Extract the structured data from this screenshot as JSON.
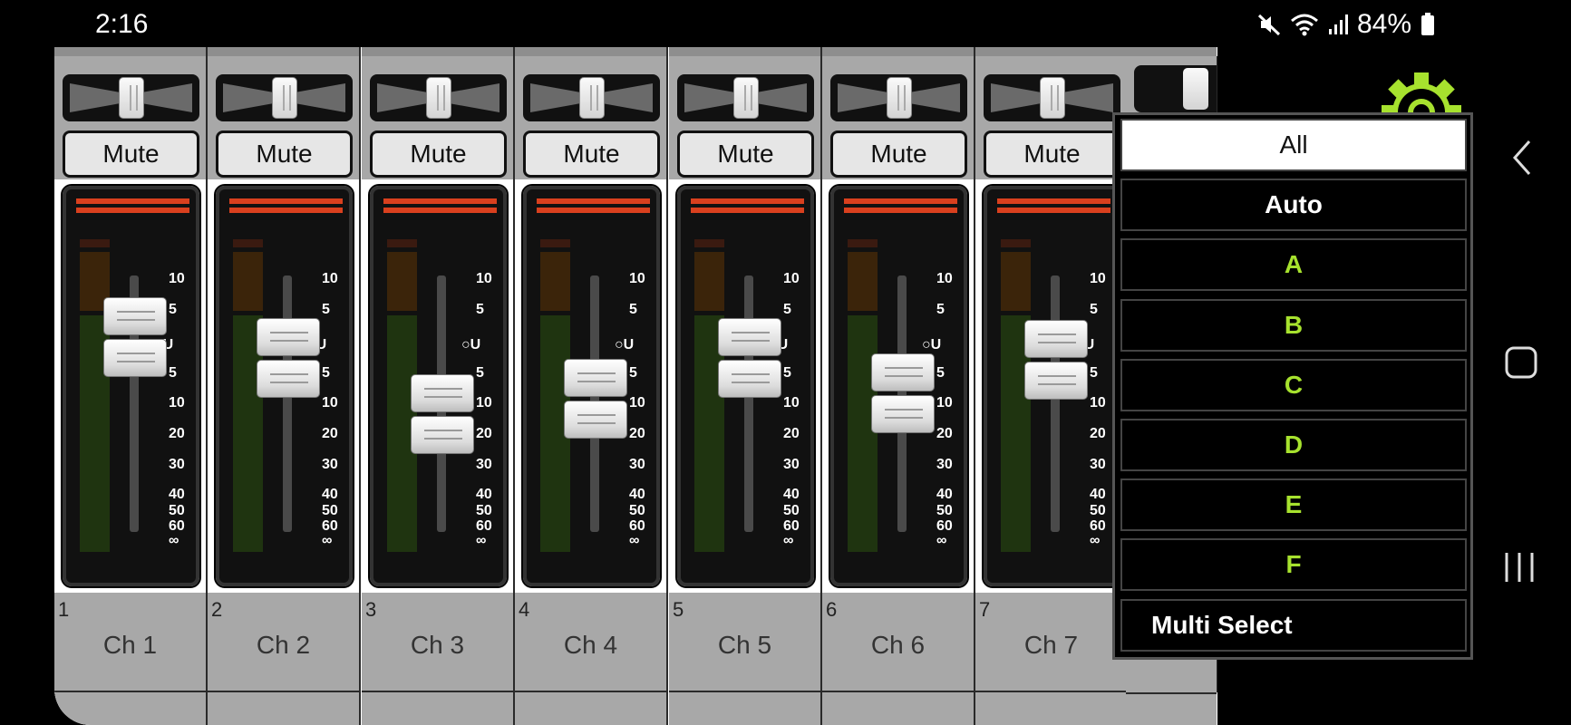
{
  "status_bar": {
    "time": "2:16",
    "battery": "84%",
    "icons": [
      "mute-icon",
      "wifi-icon",
      "signal-icon",
      "battery-icon"
    ]
  },
  "channels": [
    {
      "number": "1",
      "name": "Ch 1",
      "mute_label": "Mute",
      "fader_level": 0.76,
      "pan": 0.5
    },
    {
      "number": "2",
      "name": "Ch 2",
      "mute_label": "Mute",
      "fader_level": 0.68,
      "pan": 0.5
    },
    {
      "number": "3",
      "name": "Ch 3",
      "mute_label": "Mute",
      "fader_level": 0.46,
      "pan": 0.5
    },
    {
      "number": "4",
      "name": "Ch 4",
      "mute_label": "Mute",
      "fader_level": 0.52,
      "pan": 0.5
    },
    {
      "number": "5",
      "name": "Ch 5",
      "mute_label": "Mute",
      "fader_level": 0.68,
      "pan": 0.5
    },
    {
      "number": "6",
      "name": "Ch 6",
      "mute_label": "Mute",
      "fader_level": 0.54,
      "pan": 0.5
    },
    {
      "number": "7",
      "name": "Ch 7",
      "mute_label": "Mute",
      "fader_level": 0.67,
      "pan": 0.5
    }
  ],
  "fader_scale": [
    "10",
    "5",
    "U",
    "5",
    "10",
    "20",
    "30",
    "40",
    "50",
    "60",
    "∞"
  ],
  "view_menu": {
    "items": [
      {
        "label": "All",
        "selected": true
      },
      {
        "label": "Auto",
        "selected": false
      },
      {
        "label": "A",
        "selected": false
      },
      {
        "label": "B",
        "selected": false
      },
      {
        "label": "C",
        "selected": false
      },
      {
        "label": "D",
        "selected": false
      },
      {
        "label": "E",
        "selected": false
      },
      {
        "label": "F",
        "selected": false
      },
      {
        "label": "Multi Select",
        "selected": false
      }
    ]
  },
  "colors": {
    "accent_green": "#a7e22e",
    "clip_red": "#d9401e",
    "panel_gray": "#a8a8a8"
  },
  "nav_bar": [
    "back-icon",
    "home-icon",
    "recents-icon"
  ]
}
